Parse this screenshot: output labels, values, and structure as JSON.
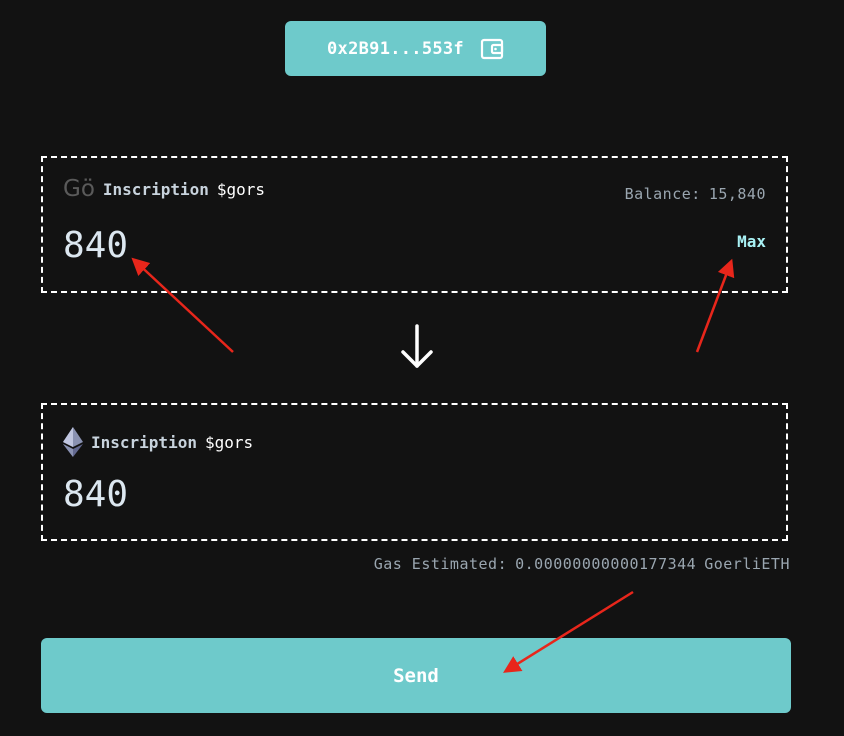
{
  "wallet": {
    "address": "0x2B91...553f",
    "icon": "wallet-icon"
  },
  "from_card": {
    "logo_text": "Gö",
    "token_name": "Inscription",
    "token_ticker": "$gors",
    "balance_label": "Balance:",
    "balance_value": "15,840",
    "amount": "840",
    "max_label": "Max"
  },
  "swap_arrow_icon": "arrow-down-icon",
  "to_card": {
    "icon": "ethereum-icon",
    "token_name": "Inscription",
    "token_ticker": "$gors",
    "amount": "840"
  },
  "gas": {
    "label": "Gas Estimated:",
    "value": "0.00000000000177344",
    "unit": "GoerliETH"
  },
  "send_label": "Send",
  "colors": {
    "background": "#121212",
    "accent": "#6ecacb",
    "max_text": "#a9f2f5",
    "annotation_arrow": "#e8261b"
  }
}
